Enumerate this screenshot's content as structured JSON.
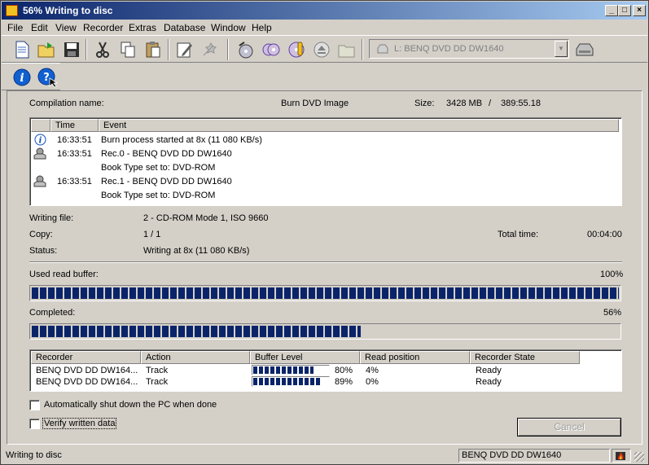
{
  "window": {
    "title": "56% Writing to disc"
  },
  "menu": [
    "File",
    "Edit",
    "View",
    "Recorder",
    "Extras",
    "Database",
    "Window",
    "Help"
  ],
  "drive_selector": {
    "value": "L: BENQ      DVD DD DW1640"
  },
  "summary": {
    "compilation_label": "Compilation name:",
    "compilation_value": "Burn DVD Image",
    "size_label": "Size:",
    "size_mb": "3428 MB",
    "size_sep": "/",
    "size_time": "389:55.18"
  },
  "log": {
    "headers": {
      "time": "Time",
      "event": "Event"
    },
    "rows": [
      {
        "icon": "info-icon",
        "time": "16:33:51",
        "event": "Burn process started at 8x (11 080 KB/s)"
      },
      {
        "icon": "recorder-icon",
        "time": "16:33:51",
        "event": "Rec.0 - BENQ        DVD DD DW1640"
      },
      {
        "icon": "",
        "time": "",
        "event": "Book Type set to: DVD-ROM"
      },
      {
        "icon": "recorder-icon",
        "time": "16:33:51",
        "event": "Rec.1 - BENQ        DVD DD DW1640"
      },
      {
        "icon": "",
        "time": "",
        "event": "Book Type set to: DVD-ROM"
      }
    ]
  },
  "details": {
    "writing_file_label": "Writing file:",
    "writing_file_value": "2 - CD-ROM Mode 1, ISO 9660",
    "copy_label": "Copy:",
    "copy_value": "1 / 1",
    "total_time_label": "Total time:",
    "total_time_value": "00:04:00",
    "status_label": "Status:",
    "status_value": "Writing at 8x (11 080 KB/s)"
  },
  "buffer": {
    "label": "Used read buffer:",
    "percent_text": "100%",
    "fraction": 1.0
  },
  "completed": {
    "label": "Completed:",
    "percent_text": "56%",
    "fraction": 0.56
  },
  "recorders": {
    "headers": {
      "recorder": "Recorder",
      "action": "Action",
      "buffer": "Buffer Level",
      "read": "Read position",
      "state": "Recorder State"
    },
    "rows": [
      {
        "recorder": "BENQ DVD DD DW164...",
        "action": "Track",
        "buffer_text": "80%",
        "buffer_fraction": 0.8,
        "read": "4%",
        "state": "Ready"
      },
      {
        "recorder": "BENQ DVD DD DW164...",
        "action": "Track",
        "buffer_text": "89%",
        "buffer_fraction": 0.89,
        "read": "0%",
        "state": "Ready"
      }
    ]
  },
  "options": {
    "shutdown_label": "Automatically shut down the PC when done",
    "verify_label": "Verify written data"
  },
  "cancel_label": "Cancel",
  "status_bar": {
    "left": "Writing to disc",
    "right": "BENQ      DVD DD DW1640"
  }
}
